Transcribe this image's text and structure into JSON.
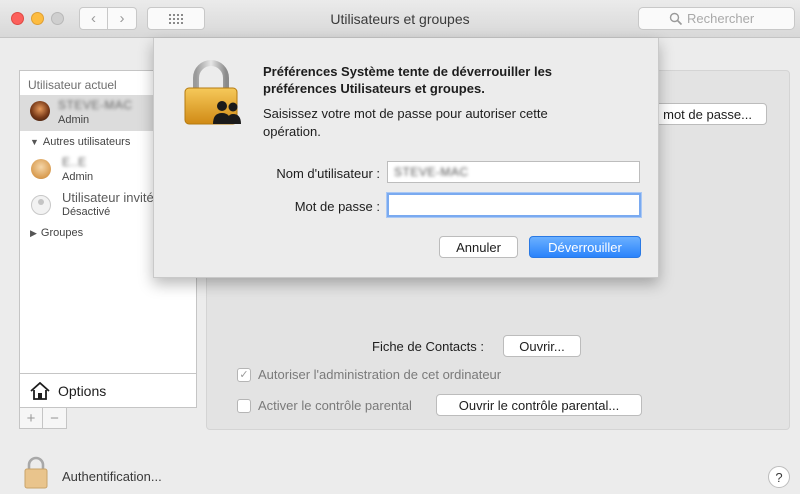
{
  "window": {
    "title": "Utilisateurs et groupes",
    "search_placeholder": "Rechercher"
  },
  "sidebar": {
    "header": "Utilisateur actuel",
    "current_user": {
      "name": "STEVE-MAC",
      "role": "Admin"
    },
    "other_users_label": "Autres utilisateurs",
    "other_users": [
      {
        "name": "E..E",
        "role": "Admin"
      },
      {
        "name": "Utilisateur invité",
        "role": "Désactivé"
      }
    ],
    "groups_label": "Groupes",
    "options_label": "Options",
    "plus": "+",
    "minus": "−"
  },
  "main": {
    "password_button": "mot de passe...",
    "contacts_label": "Fiche de Contacts :",
    "open_button": "Ouvrir...",
    "admin_checkbox": {
      "label": "Autoriser l'administration de cet ordinateur",
      "checked": true,
      "mark": "✓"
    },
    "parental_checkbox": {
      "label": "Activer le contrôle parental",
      "checked": false
    },
    "parental_button": "Ouvrir le contrôle parental..."
  },
  "bottom": {
    "auth_label": "Authentification...",
    "help": "?"
  },
  "dialog": {
    "title": "Préférences Système tente de déverrouiller les préférences Utilisateurs et groupes.",
    "message": "Saisissez votre mot de passe pour autoriser cette opération.",
    "username_label": "Nom d'utilisateur :",
    "username_value": "STEVE-MAC",
    "password_label": "Mot de passe :",
    "password_value": "",
    "cancel_button": "Annuler",
    "unlock_button": "Déverrouiller"
  },
  "colors": {
    "accent": "#2a83fb",
    "lock_gold": "#e8a832",
    "selected_row": "#dcdcdc"
  },
  "icons": {
    "search": "search-icon",
    "home": "home-icon",
    "lock": "lock-icon",
    "help": "help-icon"
  }
}
